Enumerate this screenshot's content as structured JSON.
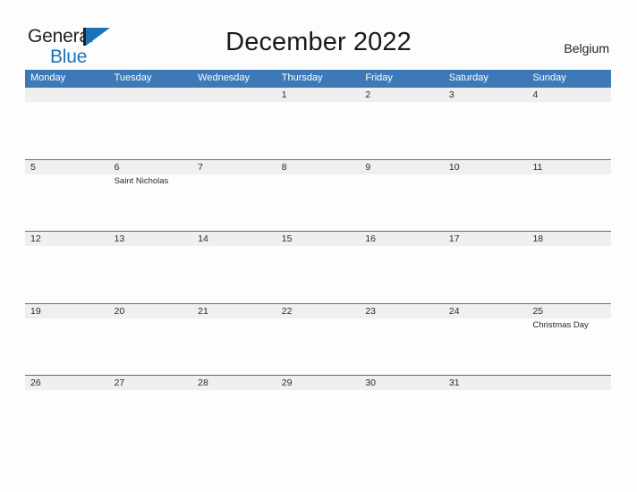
{
  "brand": {
    "name_line1": "General",
    "name_line2": "Blue",
    "mark": "flag-triangle-icon",
    "accent_color": "#1a72b8",
    "text_color": "#231f20"
  },
  "header": {
    "title": "December 2022",
    "region": "Belgium"
  },
  "theme": {
    "header_blue": "#3d79b7",
    "band_gray": "#efefef",
    "page_background": "#fdfdfd",
    "text_color": "#2b2b2b"
  },
  "calendar": {
    "weekday_labels": [
      "Monday",
      "Tuesday",
      "Wednesday",
      "Thursday",
      "Friday",
      "Saturday",
      "Sunday"
    ],
    "weeks": [
      {
        "days": [
          {
            "num": "",
            "event": ""
          },
          {
            "num": "",
            "event": ""
          },
          {
            "num": "",
            "event": ""
          },
          {
            "num": "1",
            "event": ""
          },
          {
            "num": "2",
            "event": ""
          },
          {
            "num": "3",
            "event": ""
          },
          {
            "num": "4",
            "event": ""
          }
        ]
      },
      {
        "days": [
          {
            "num": "5",
            "event": ""
          },
          {
            "num": "6",
            "event": "Saint Nicholas"
          },
          {
            "num": "7",
            "event": ""
          },
          {
            "num": "8",
            "event": ""
          },
          {
            "num": "9",
            "event": ""
          },
          {
            "num": "10",
            "event": ""
          },
          {
            "num": "11",
            "event": ""
          }
        ]
      },
      {
        "days": [
          {
            "num": "12",
            "event": ""
          },
          {
            "num": "13",
            "event": ""
          },
          {
            "num": "14",
            "event": ""
          },
          {
            "num": "15",
            "event": ""
          },
          {
            "num": "16",
            "event": ""
          },
          {
            "num": "17",
            "event": ""
          },
          {
            "num": "18",
            "event": ""
          }
        ]
      },
      {
        "days": [
          {
            "num": "19",
            "event": ""
          },
          {
            "num": "20",
            "event": ""
          },
          {
            "num": "21",
            "event": ""
          },
          {
            "num": "22",
            "event": ""
          },
          {
            "num": "23",
            "event": ""
          },
          {
            "num": "24",
            "event": ""
          },
          {
            "num": "25",
            "event": "Christmas Day"
          }
        ]
      },
      {
        "days": [
          {
            "num": "26",
            "event": ""
          },
          {
            "num": "27",
            "event": ""
          },
          {
            "num": "28",
            "event": ""
          },
          {
            "num": "29",
            "event": ""
          },
          {
            "num": "30",
            "event": ""
          },
          {
            "num": "31",
            "event": ""
          },
          {
            "num": "",
            "event": ""
          }
        ]
      }
    ]
  }
}
